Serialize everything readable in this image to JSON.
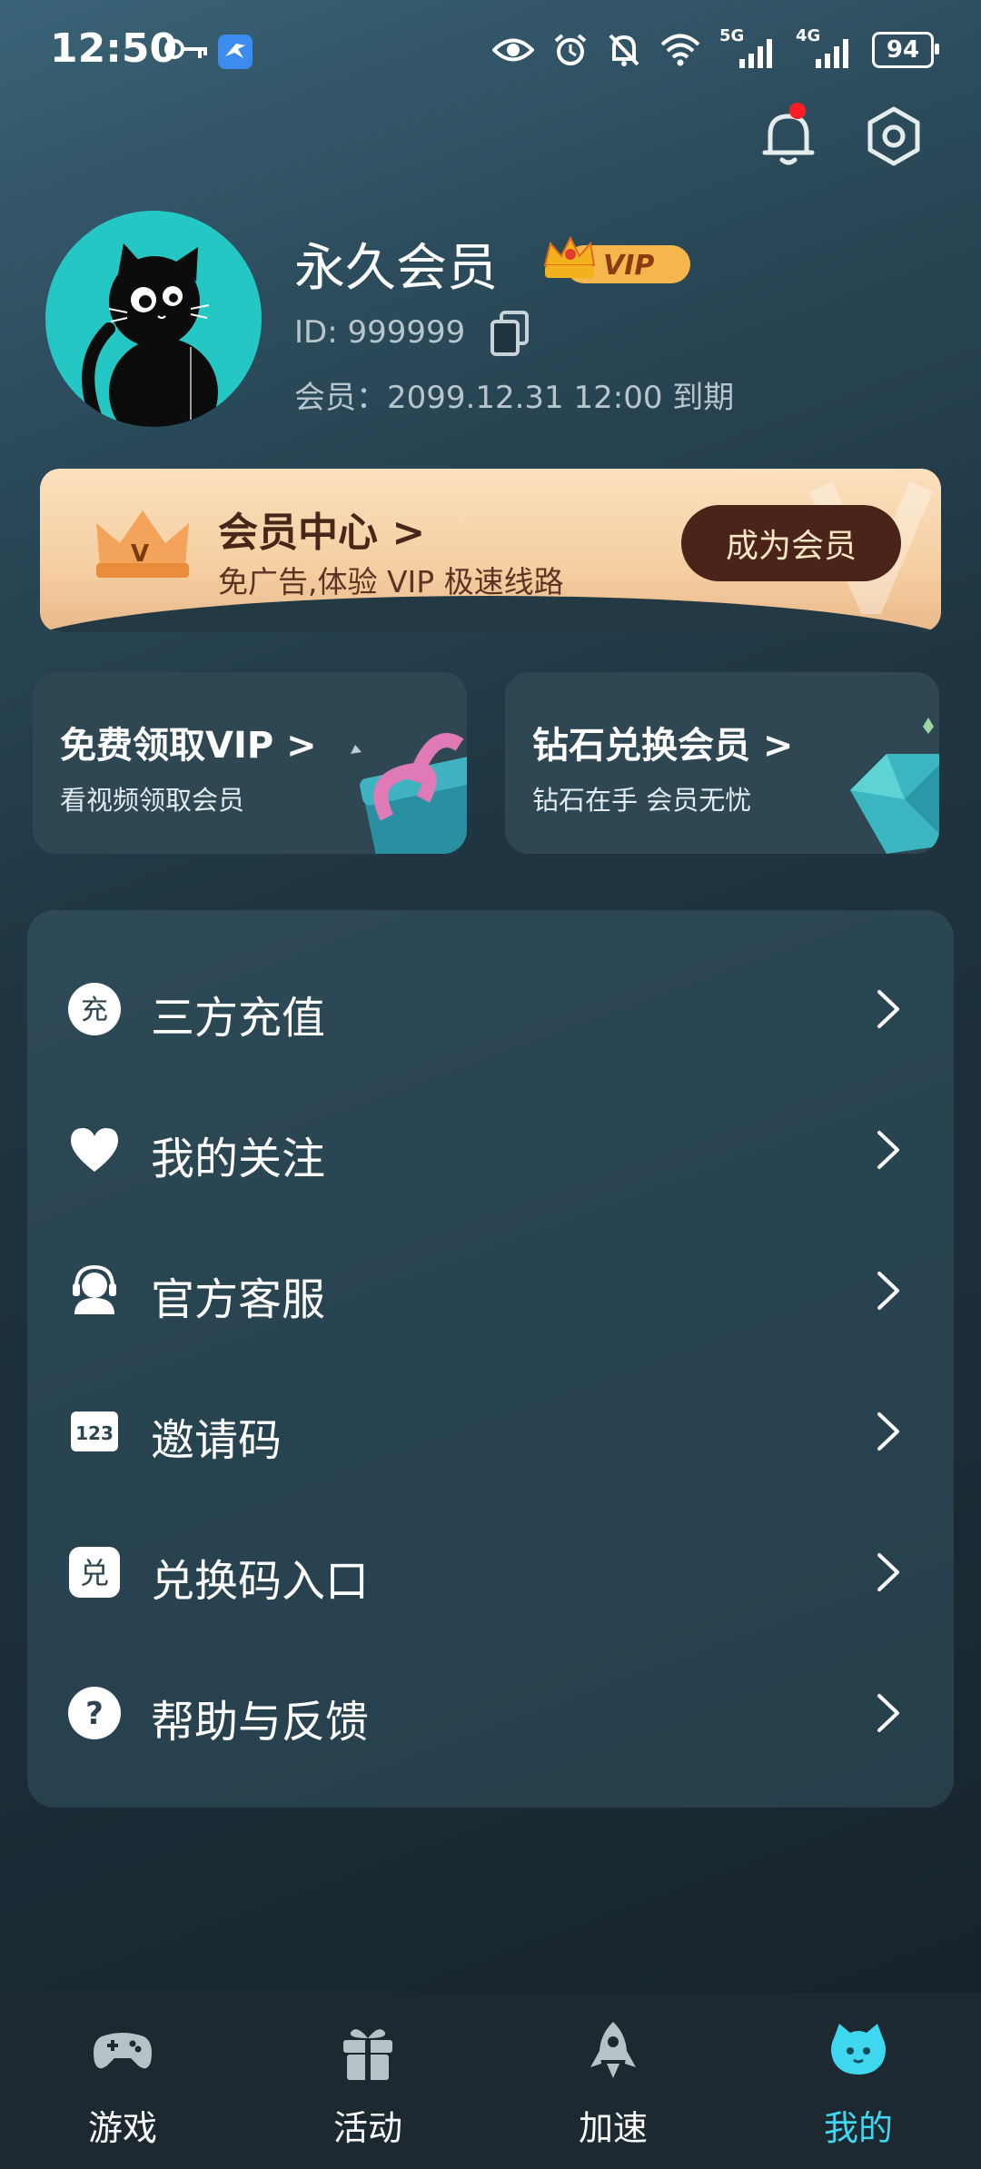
{
  "status_bar": {
    "time": "12:50",
    "battery": "94",
    "signal_5g": "5G",
    "signal_4g": "4G"
  },
  "profile": {
    "name": "永久会员",
    "vip_label": "VIP",
    "id": "ID: 999999",
    "expiry": "会员：2099.12.31 12:00 到期"
  },
  "member_center": {
    "title": "会员中心 >",
    "subtitle": "免广告,体验 VIP 极速线路",
    "button": "成为会员",
    "badge_letter": "V"
  },
  "promo_cards": [
    {
      "title": "免费领取VIP >",
      "subtitle": "看视频领取会员"
    },
    {
      "title": "钻石兑换会员 >",
      "subtitle": "钻石在手 会员无忧"
    }
  ],
  "menu": {
    "items": [
      {
        "label": "三方充值",
        "icon_text": "充"
      },
      {
        "label": "我的关注",
        "icon_text": ""
      },
      {
        "label": "官方客服",
        "icon_text": ""
      },
      {
        "label": "邀请码",
        "icon_text": "123"
      },
      {
        "label": "兑换码入口",
        "icon_text": "兑"
      },
      {
        "label": "帮助与反馈",
        "icon_text": "?"
      }
    ]
  },
  "bottom_nav": {
    "items": [
      {
        "label": "游戏"
      },
      {
        "label": "活动"
      },
      {
        "label": "加速"
      },
      {
        "label": "我的"
      }
    ],
    "active_color": "#3fd6ef"
  }
}
